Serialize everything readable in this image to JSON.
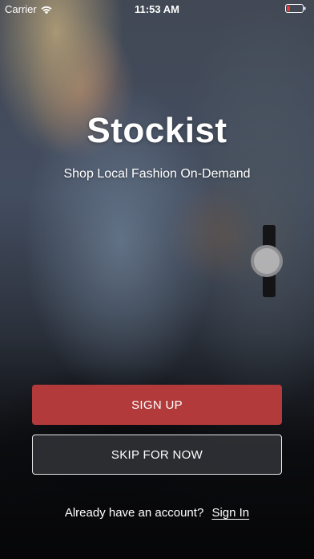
{
  "status_bar": {
    "carrier": "Carrier",
    "time": "11:53 AM",
    "battery_color": "#e53935"
  },
  "hero": {
    "title": "Stockist",
    "subtitle": "Shop Local Fashion On-Demand"
  },
  "actions": {
    "signup_label": "SIGN UP",
    "skip_label": "SKIP FOR NOW"
  },
  "signin": {
    "prompt": "Already have an account?",
    "link_label": "Sign In"
  },
  "colors": {
    "primary_button": "#b23a3a",
    "secondary_button_border": "#e6e6e6"
  }
}
